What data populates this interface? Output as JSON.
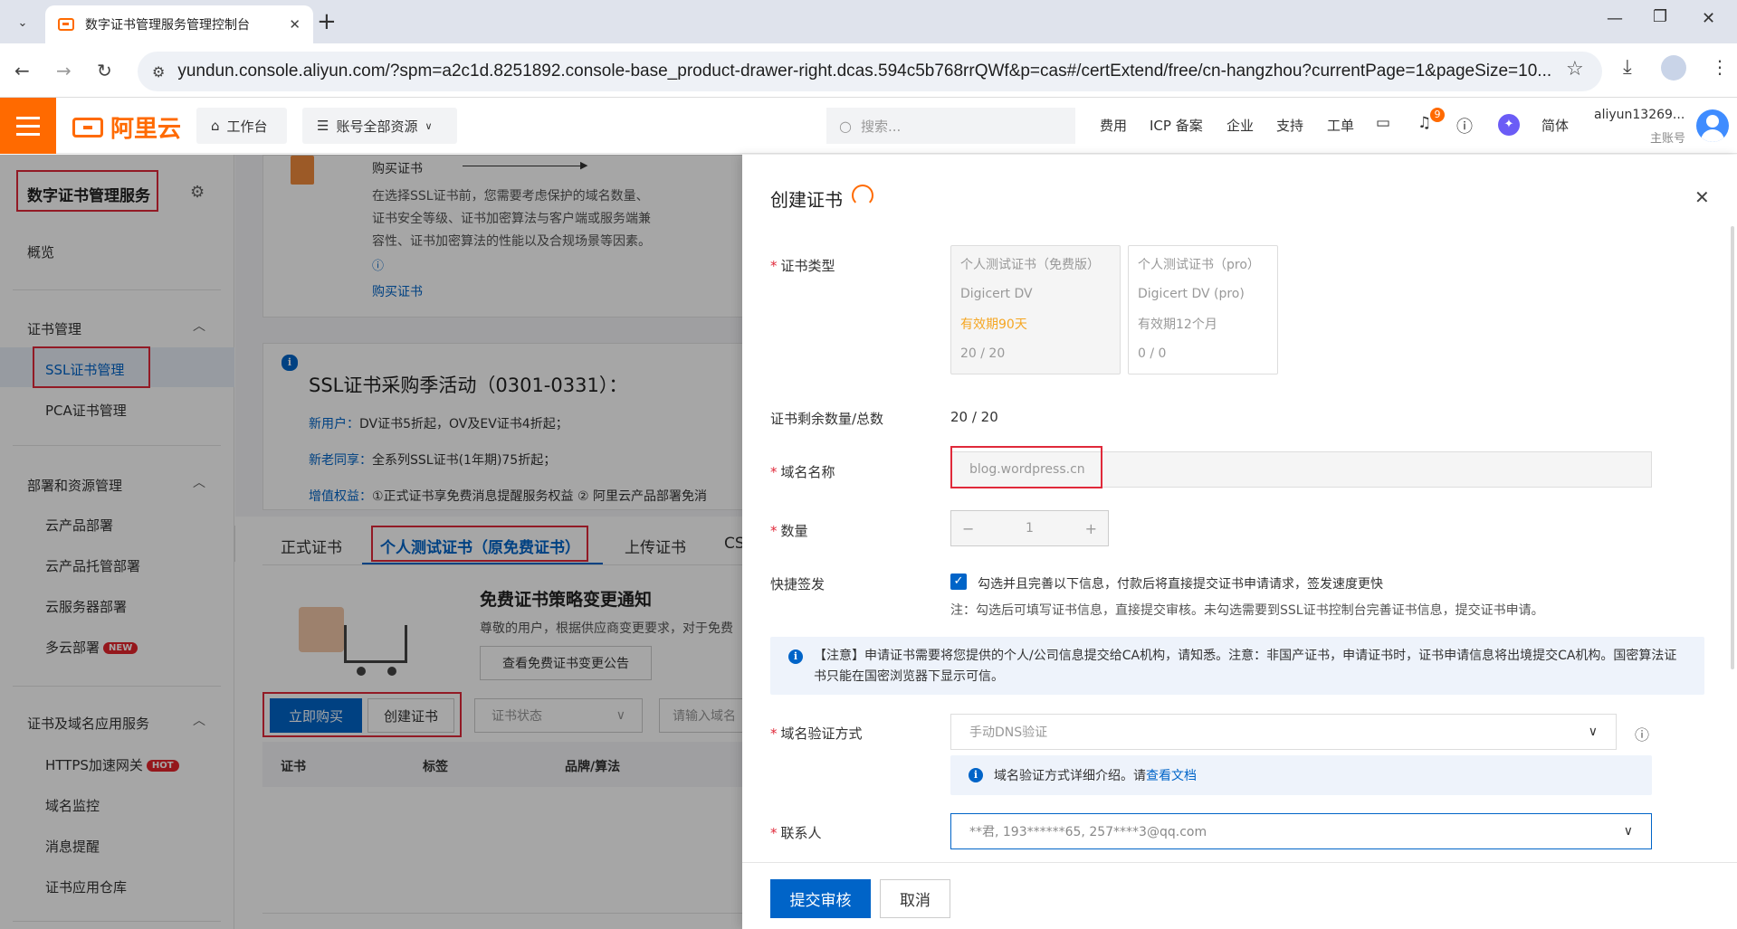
{
  "browser": {
    "tab_title": "数字证书管理服务管理控制台",
    "url": "yundun.console.aliyun.com/?spm=a2c1d.8251892.console-base_product-drawer-right.dcas.594c5b768rrQWf&p=cas#/certExtend/free/cn-hangzhou?currentPage=1&pageSize=10..."
  },
  "topnav": {
    "logo_text": "阿里云",
    "workbench": "工作台",
    "resources": "账号全部资源",
    "search_placeholder": "搜索...",
    "links": [
      "费用",
      "ICP 备案",
      "企业",
      "支持",
      "工单"
    ],
    "notification_count": "9",
    "lang": "简体",
    "user_name": "aliyun13269...",
    "user_role": "主账号"
  },
  "sidebar": {
    "title": "数字证书管理服务",
    "overview": "概览",
    "sections": [
      {
        "label": "证书管理",
        "items": [
          "SSL证书管理",
          "PCA证书管理"
        ]
      },
      {
        "label": "部署和资源管理",
        "items": [
          "云产品部署",
          "云产品托管部署",
          "云服务器部署",
          "多云部署"
        ]
      },
      {
        "label": "证书及域名应用服务",
        "items": [
          "HTTPS加速网关",
          "域名监控",
          "消息提醒",
          "证书应用仓库"
        ]
      }
    ],
    "badge_new": "NEW",
    "badge_hot": "HOT"
  },
  "main": {
    "buy_title": "购买证书",
    "buy_desc": [
      "在选择SSL证书前，您需要考虑保护的域名数量、",
      "证书安全等级、证书加密算法与客户端或服务端兼",
      "容性、证书加密算法的性能以及合规场景等因素。"
    ],
    "buy_link": "购买证书",
    "promo_title": "SSL证书采购季活动（0301-0331）：",
    "promo_lines": [
      {
        "label": "新用户：",
        "text": "DV证书5折起，OV及EV证书4折起；"
      },
      {
        "label": "新老同享：",
        "text": "全系列SSL证书(1年期)75折起；"
      },
      {
        "label": "增值权益：",
        "text": "①正式证书享免费消息提醒服务权益 ② 阿里云产品部署免消"
      }
    ],
    "tabs": [
      "正式证书",
      "个人测试证书（原免费证书）",
      "上传证书",
      "CS"
    ],
    "notice_title": "免费证书策略变更通知",
    "notice_text": "尊敬的用户，根据供应商变更要求，对于免费",
    "notice_button": "查看免费证书变更公告",
    "buy_now": "立即购买",
    "create_cert": "创建证书",
    "status_filter": "证书状态",
    "domain_search": "请输入域名",
    "columns": [
      "证书",
      "标签",
      "品牌/算法"
    ]
  },
  "drawer": {
    "title": "创建证书",
    "cert_type_label": "证书类型",
    "options": [
      {
        "name": "个人测试证书（免费版）",
        "brand": "Digicert DV",
        "validity": "有效期90天",
        "count": "20 / 20"
      },
      {
        "name": "个人测试证书（pro）",
        "brand": "Digicert DV (pro)",
        "validity": "有效期12个月",
        "count": "0 / 0"
      }
    ],
    "remaining_label": "证书剩余数量/总数",
    "remaining_value": "20 / 20",
    "domain_label": "域名名称",
    "domain_value": "blog.wordpress.cn",
    "qty_label": "数量",
    "qty_value": "1",
    "quick_label": "快捷签发",
    "quick_check_text": "勾选并且完善以下信息，付款后将直接提交证书申请请求，签发速度更快",
    "quick_note": "注：勾选后可填写证书信息，直接提交审核。未勾选需要到SSL证书控制台完善证书信息，提交证书申请。",
    "notice": "【注意】申请证书需要将您提供的个人/公司信息提交给CA机构，请知悉。注意：非国产证书，申请证书时，证书申请信息将出境提交CA机构。国密算法证书只能在国密浏览器下显示可信。",
    "verify_label": "域名验证方式",
    "verify_value": "手动DNS验证",
    "verify_info": "域名验证方式详细介绍。请",
    "verify_link": "查看文档",
    "contact_label": "联系人",
    "contact_value": "**君, 193******65, 257****3@qq.com",
    "submit": "提交审核",
    "cancel": "取消"
  },
  "colors": {
    "brand": "#ff6a00",
    "primary": "#0064c8",
    "highlight": "#e0293a",
    "validity": "#f5a623"
  }
}
